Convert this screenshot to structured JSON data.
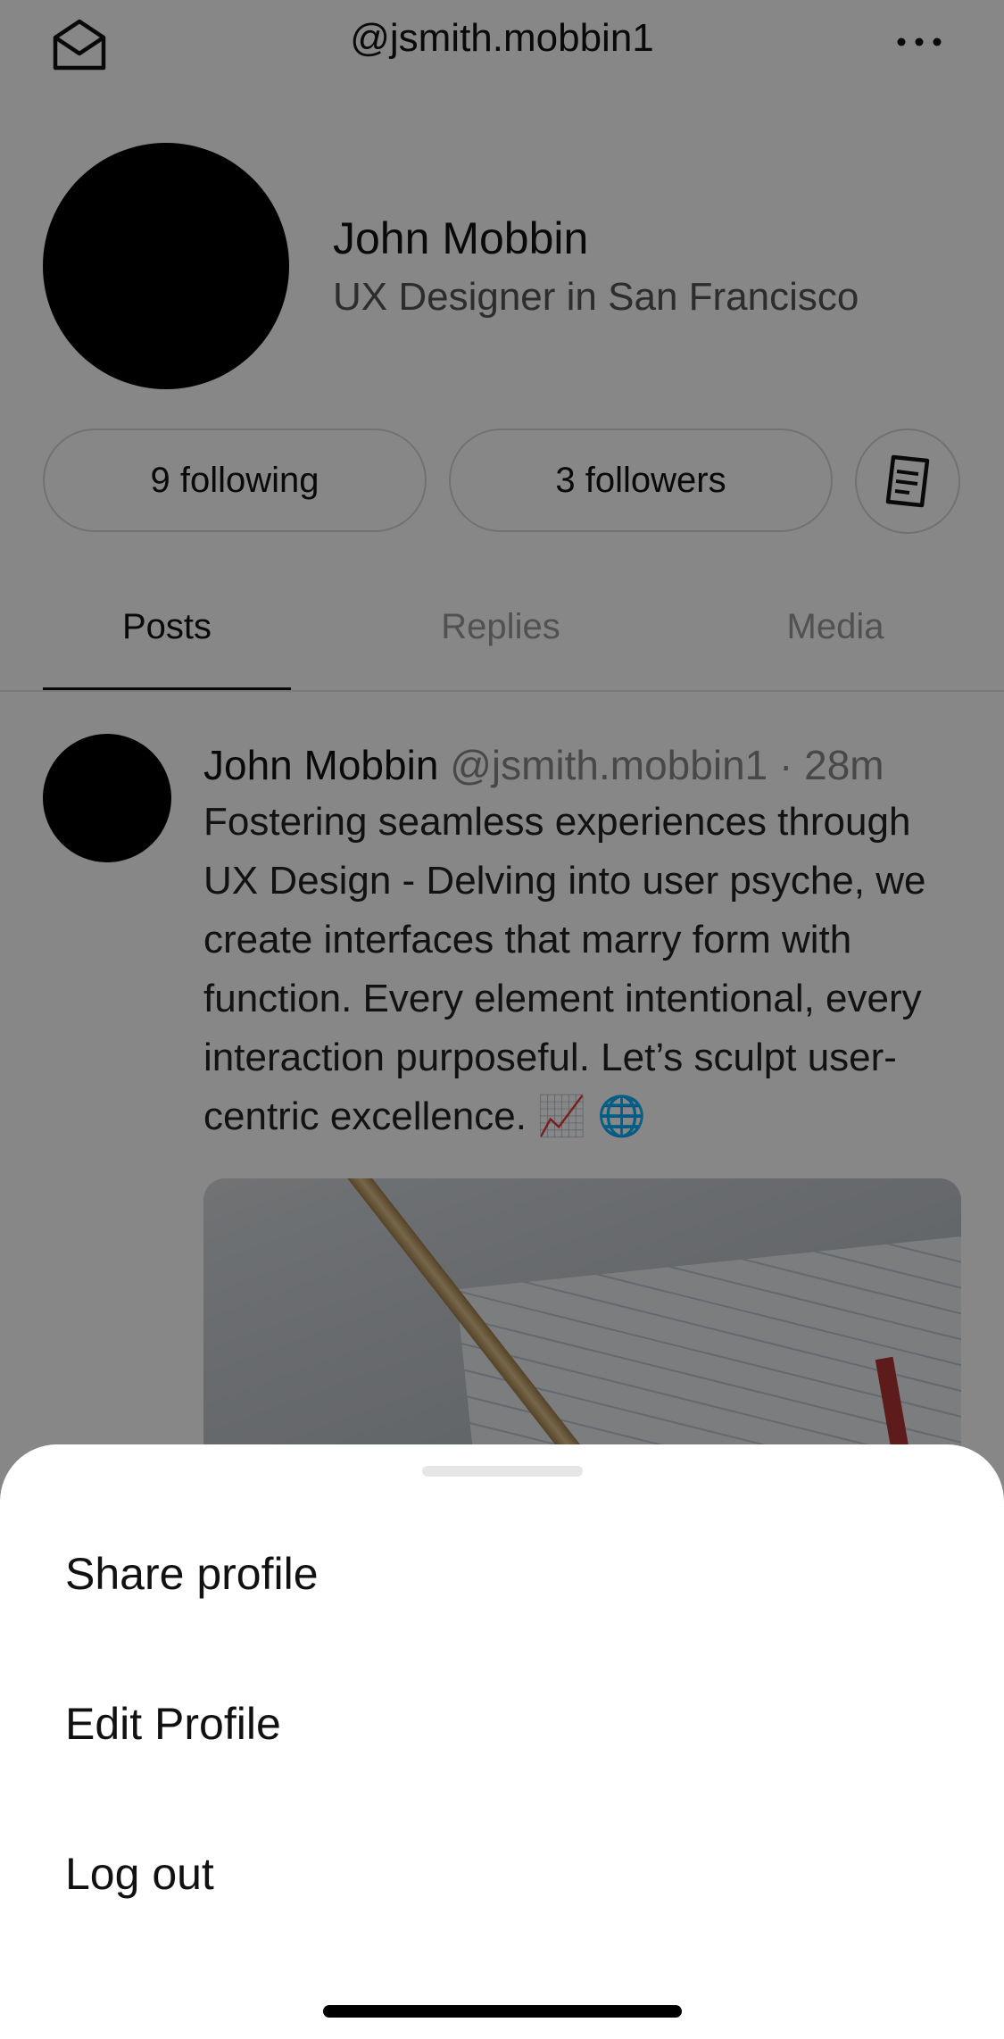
{
  "header": {
    "handle": "@jsmith.mobbin1",
    "left_icon": "envelope-open-icon",
    "right_icon": "more-horizontal-icon"
  },
  "profile": {
    "name": "John Mobbin",
    "bio": "UX Designer in San Francisco"
  },
  "stats": {
    "following": "9 following",
    "followers": "3 followers",
    "extra_icon": "document-icon"
  },
  "tabs": [
    {
      "label": "Posts",
      "active": true
    },
    {
      "label": "Replies",
      "active": false
    },
    {
      "label": "Media",
      "active": false
    }
  ],
  "post": {
    "author": "John Mobbin",
    "handle": "@jsmith.mobbin1",
    "separator": "·",
    "time": "28m",
    "body": "Fostering seamless experiences through UX Design - Delving into user psyche, we create interfaces that marry form with function. Every element intentional, every interaction purposeful. Let’s sculpt user-centric excellence. 📈 🌐"
  },
  "sheet": {
    "items": [
      {
        "label": "Share profile"
      },
      {
        "label": "Edit Profile"
      },
      {
        "label": "Log out"
      }
    ]
  },
  "colors": {
    "overlay": "#000000",
    "text_primary": "#111111",
    "text_secondary": "#888888",
    "divider": "#e4e4e4"
  }
}
